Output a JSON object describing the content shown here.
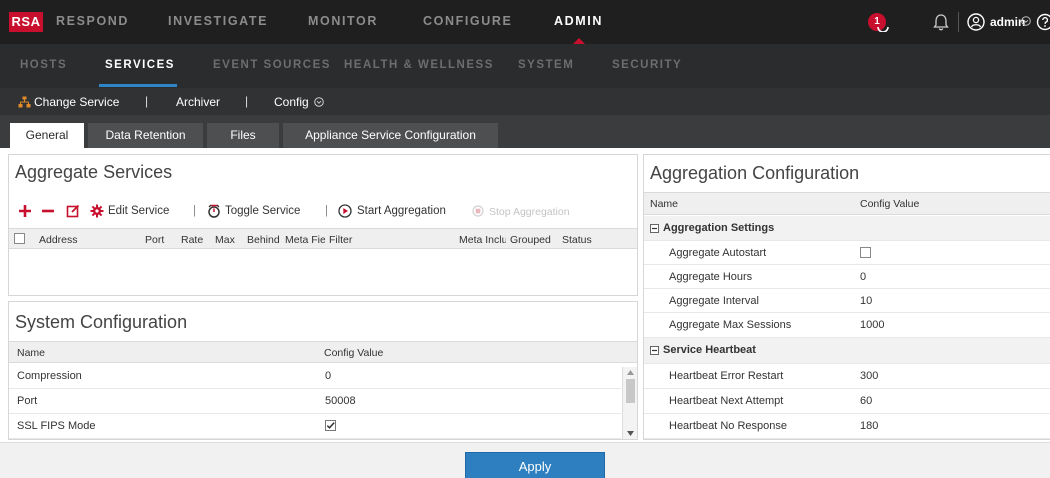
{
  "top_nav": {
    "logo": "RSA",
    "items": [
      "RESPOND",
      "INVESTIGATE",
      "MONITOR",
      "CONFIGURE",
      "ADMIN"
    ],
    "active": "ADMIN",
    "notification_count": "1",
    "user": "admin",
    "accent_color": "#c8102e"
  },
  "sub_nav": {
    "items": [
      "HOSTS",
      "SERVICES",
      "EVENT SOURCES",
      "HEALTH & WELLNESS",
      "SYSTEM",
      "SECURITY"
    ],
    "active": "SERVICES",
    "underline_color": "#2e86c8"
  },
  "service_bar": {
    "change_service": "Change Service",
    "service_name": "Archiver",
    "view": "Config"
  },
  "tabs": [
    "General",
    "Data Retention",
    "Files",
    "Appliance Service Configuration"
  ],
  "active_tab": "General",
  "aggregate_services": {
    "title": "Aggregate Services",
    "toolbar": {
      "edit_service": "Edit Service",
      "toggle_service": "Toggle Service",
      "start_aggregation": "Start Aggregation",
      "stop_aggregation": "Stop Aggregation"
    },
    "columns": [
      "Address",
      "Port",
      "Rate",
      "Max",
      "Behind",
      "Meta Fields",
      "Filter",
      "Meta Include",
      "Grouped",
      "Status"
    ]
  },
  "system_configuration": {
    "title": "System Configuration",
    "columns": [
      "Name",
      "Config Value"
    ],
    "rows": [
      {
        "name": "Compression",
        "value": "0"
      },
      {
        "name": "Port",
        "value": "50008"
      },
      {
        "name": "SSL FIPS Mode",
        "value": "checked"
      }
    ]
  },
  "aggregation_configuration": {
    "title": "Aggregation Configuration",
    "columns": [
      "Name",
      "Config Value"
    ],
    "groups": [
      {
        "label": "Aggregation Settings",
        "rows": [
          {
            "name": "Aggregate Autostart",
            "value": "unchecked"
          },
          {
            "name": "Aggregate Hours",
            "value": "0"
          },
          {
            "name": "Aggregate Interval",
            "value": "10"
          },
          {
            "name": "Aggregate Max Sessions",
            "value": "1000"
          }
        ]
      },
      {
        "label": "Service Heartbeat",
        "rows": [
          {
            "name": "Heartbeat Error Restart",
            "value": "300"
          },
          {
            "name": "Heartbeat Next Attempt",
            "value": "60"
          },
          {
            "name": "Heartbeat No Response",
            "value": "180"
          }
        ]
      }
    ]
  },
  "footer": {
    "apply": "Apply",
    "button_color": "#2e7fc0"
  }
}
